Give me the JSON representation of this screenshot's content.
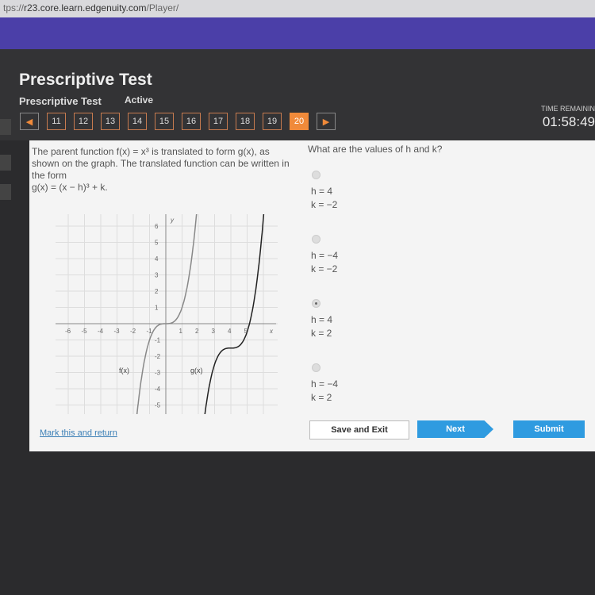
{
  "browser": {
    "url_prefix": "tps://",
    "url_host": "r23.core.learn.edgenuity.com",
    "url_path": "/Player/"
  },
  "header": {
    "title": "Prescriptive Test",
    "subtitle": "Prescriptive Test",
    "status": "Active",
    "time_label": "TIME REMAININ",
    "time": "01:58:49"
  },
  "nav": {
    "prev": "◀",
    "next": "▶",
    "questions": [
      "11",
      "12",
      "13",
      "14",
      "15",
      "16",
      "17",
      "18",
      "19",
      "20"
    ],
    "current": "20"
  },
  "question": {
    "line1": "The parent function f(x) = x³ is translated to form g(x), as shown on the graph. The translated function can be written in the form",
    "formula": "g(x) = (x − h)³ + k."
  },
  "graph": {
    "x_ticks": [
      "-6",
      "-5",
      "-4",
      "-3",
      "-2",
      "-1",
      "1",
      "2",
      "3",
      "4",
      "5"
    ],
    "y_ticks": [
      "6",
      "5",
      "4",
      "3",
      "2",
      "1",
      "-1",
      "-2",
      "-3",
      "-4",
      "-5"
    ],
    "x_label": "x",
    "y_label": "y",
    "f_label": "f(x)",
    "g_label": "g(x)"
  },
  "answer": {
    "prompt": "What are the values of h and k?",
    "options": [
      {
        "h": "h = 4",
        "k": "k = −2",
        "selected": false
      },
      {
        "h": "h = −4",
        "k": "k = −2",
        "selected": false
      },
      {
        "h": "h = 4",
        "k": "k = 2",
        "selected": true
      },
      {
        "h": "h = −4",
        "k": "k = 2",
        "selected": false
      }
    ]
  },
  "footer": {
    "mark": "Mark this and return",
    "save": "Save and Exit",
    "next": "Next",
    "submit": "Submit"
  },
  "colors": {
    "accent": "#f08a3a",
    "primary": "#2f9be0",
    "band": "#4b3fa8"
  }
}
